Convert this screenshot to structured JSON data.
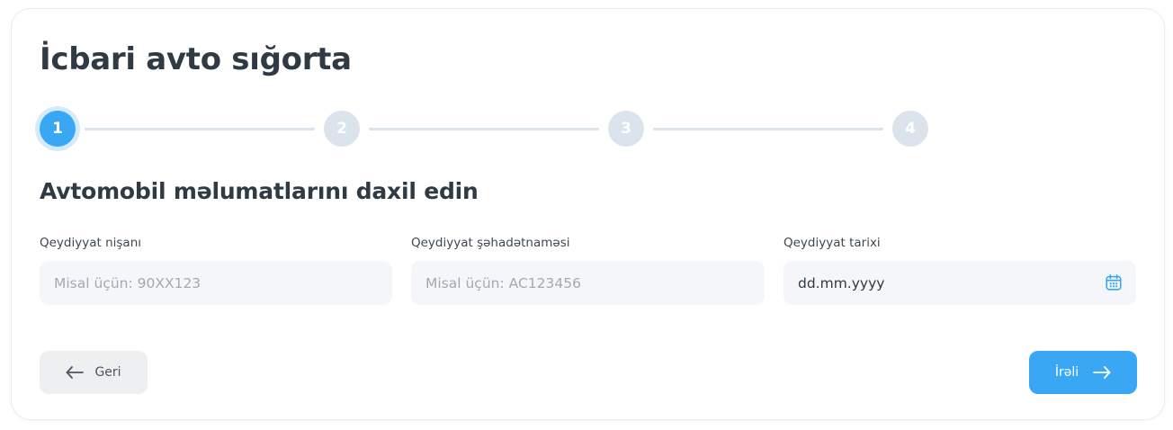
{
  "page": {
    "title": "İcbari avto sığorta",
    "subtitle": "Avtomobil məlumatlarını daxil edin"
  },
  "stepper": {
    "current": 1,
    "steps": [
      "1",
      "2",
      "3",
      "4"
    ]
  },
  "form": {
    "plate": {
      "label": "Qeydiyyat nişanı",
      "placeholder": "Misal üçün: 90XX123"
    },
    "certificate": {
      "label": "Qeydiyyat şəhadətnaməsi",
      "placeholder": "Misal üçün: AC123456"
    },
    "date": {
      "label": "Qeydiyyat tarixi",
      "value": "dd.mm.yyyy",
      "icon": "calendar-icon"
    }
  },
  "actions": {
    "back_label": "Geri",
    "back_icon": "arrow-left-icon",
    "next_label": "İrəli",
    "next_icon": "arrow-right-icon"
  },
  "colors": {
    "accent": "#39a7f4",
    "inactive_step": "#dbe4ec",
    "field_bg": "#f4f6f9"
  }
}
